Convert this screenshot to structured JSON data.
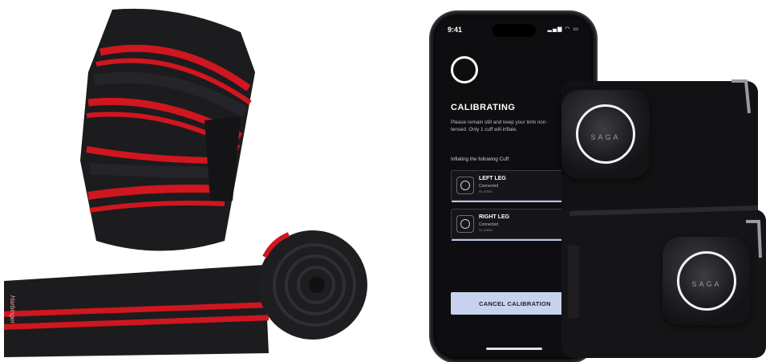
{
  "phone": {
    "status_time": "9:41",
    "status_icons": "▂▄▆ ◠ ▭",
    "title": "CALIBRATING",
    "description": "Please remain still and keep your limb non-tensed. Only 1 cuff will inflate.",
    "inflating_label": "Inflating the following Cuff:",
    "cuffs": [
      {
        "name": "LEFT LEG",
        "status": "Connected",
        "id": "SL-00001",
        "progress": 0.85
      },
      {
        "name": "RIGHT LEG",
        "status": "Connected",
        "id": "SL-00002",
        "progress": 0.82
      }
    ],
    "cancel_label": "CANCEL CALIBRATION"
  },
  "products": {
    "wrap_brand": "Harbinger",
    "device_brand": "SAGA"
  },
  "colors": {
    "wrap_black": "#1b1b1d",
    "wrap_red": "#d0161f",
    "phone_bg": "#0e0e11",
    "button_bg": "#c7d3ee"
  }
}
